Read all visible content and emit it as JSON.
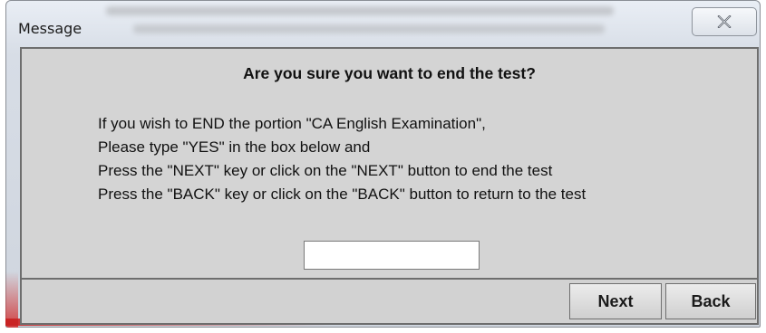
{
  "window": {
    "title": "Message",
    "close_glyph": "✕"
  },
  "dialog": {
    "heading": "Are you sure you want to end the test?",
    "lines": [
      "If you wish to END the portion \"CA English Examination\",",
      "Please type \"YES\" in the box below and",
      "Press the \"NEXT\" key or click on the \"NEXT\" button to end the test",
      "Press the \"BACK\" key or click on the \"BACK\" button to return to the test"
    ],
    "input": {
      "value": "",
      "placeholder": ""
    }
  },
  "buttons": {
    "next_label": "Next",
    "back_label": "Back"
  }
}
